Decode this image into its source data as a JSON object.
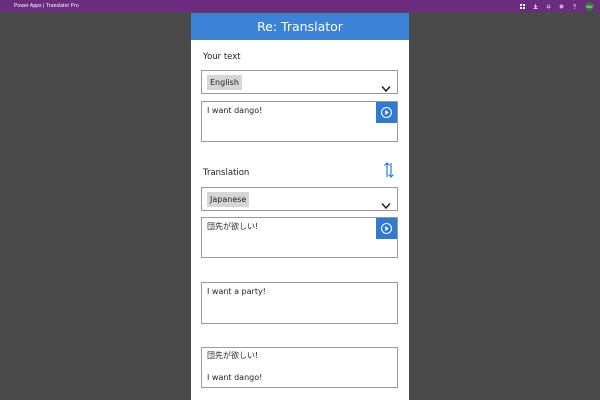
{
  "topbar": {
    "brand": "Power Apps  |  Translator Pro",
    "icons": [
      "grid-icon",
      "download-icon",
      "bell-icon",
      "gear-icon",
      "help-icon"
    ],
    "avatar": "MV"
  },
  "app": {
    "title": "Re: Translator",
    "source": {
      "label": "Your text",
      "language": "English",
      "text": "I want dango!"
    },
    "target": {
      "label": "Translation",
      "language": "Japanese",
      "text": "団先が欲しい!"
    },
    "extra_input": "I want a party!",
    "history": {
      "line1": "団先が欲しい!",
      "line2": "I want dango!"
    }
  },
  "colors": {
    "topbar": "#6b2c7f",
    "header": "#3c82d6",
    "play_button": "#2f7bd4",
    "swap_icon": "#2f7bd4",
    "background": "#4a4a4a"
  }
}
